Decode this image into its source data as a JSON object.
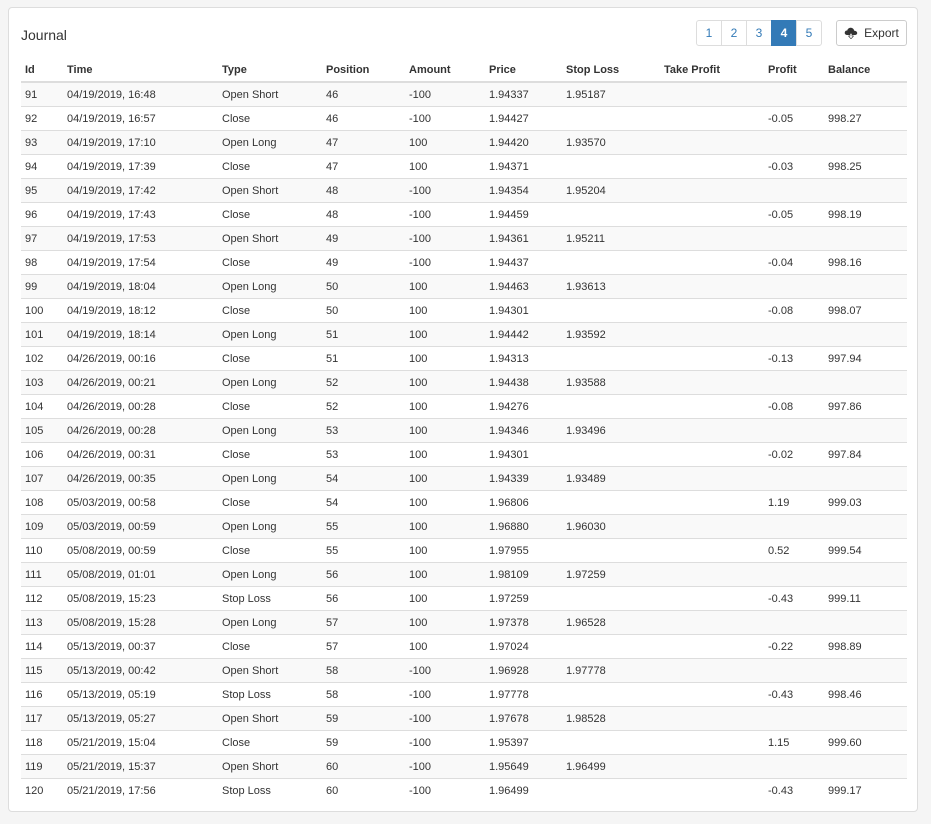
{
  "panel": {
    "title": "Journal"
  },
  "pagination": {
    "pages": [
      "1",
      "2",
      "3",
      "4",
      "5"
    ],
    "active_index": 3
  },
  "export": {
    "label": "Export",
    "icon": "cloud-download-icon"
  },
  "table": {
    "columns": [
      "Id",
      "Time",
      "Type",
      "Position",
      "Amount",
      "Price",
      "Stop Loss",
      "Take Profit",
      "Profit",
      "Balance"
    ],
    "rows": [
      [
        "91",
        "04/19/2019, 16:48",
        "Open Short",
        "46",
        "-100",
        "1.94337",
        "1.95187",
        "",
        "",
        ""
      ],
      [
        "92",
        "04/19/2019, 16:57",
        "Close",
        "46",
        "-100",
        "1.94427",
        "",
        "",
        "-0.05",
        "998.27"
      ],
      [
        "93",
        "04/19/2019, 17:10",
        "Open Long",
        "47",
        "100",
        "1.94420",
        "1.93570",
        "",
        "",
        ""
      ],
      [
        "94",
        "04/19/2019, 17:39",
        "Close",
        "47",
        "100",
        "1.94371",
        "",
        "",
        "-0.03",
        "998.25"
      ],
      [
        "95",
        "04/19/2019, 17:42",
        "Open Short",
        "48",
        "-100",
        "1.94354",
        "1.95204",
        "",
        "",
        ""
      ],
      [
        "96",
        "04/19/2019, 17:43",
        "Close",
        "48",
        "-100",
        "1.94459",
        "",
        "",
        "-0.05",
        "998.19"
      ],
      [
        "97",
        "04/19/2019, 17:53",
        "Open Short",
        "49",
        "-100",
        "1.94361",
        "1.95211",
        "",
        "",
        ""
      ],
      [
        "98",
        "04/19/2019, 17:54",
        "Close",
        "49",
        "-100",
        "1.94437",
        "",
        "",
        "-0.04",
        "998.16"
      ],
      [
        "99",
        "04/19/2019, 18:04",
        "Open Long",
        "50",
        "100",
        "1.94463",
        "1.93613",
        "",
        "",
        ""
      ],
      [
        "100",
        "04/19/2019, 18:12",
        "Close",
        "50",
        "100",
        "1.94301",
        "",
        "",
        "-0.08",
        "998.07"
      ],
      [
        "101",
        "04/19/2019, 18:14",
        "Open Long",
        "51",
        "100",
        "1.94442",
        "1.93592",
        "",
        "",
        ""
      ],
      [
        "102",
        "04/26/2019, 00:16",
        "Close",
        "51",
        "100",
        "1.94313",
        "",
        "",
        "-0.13",
        "997.94"
      ],
      [
        "103",
        "04/26/2019, 00:21",
        "Open Long",
        "52",
        "100",
        "1.94438",
        "1.93588",
        "",
        "",
        ""
      ],
      [
        "104",
        "04/26/2019, 00:28",
        "Close",
        "52",
        "100",
        "1.94276",
        "",
        "",
        "-0.08",
        "997.86"
      ],
      [
        "105",
        "04/26/2019, 00:28",
        "Open Long",
        "53",
        "100",
        "1.94346",
        "1.93496",
        "",
        "",
        ""
      ],
      [
        "106",
        "04/26/2019, 00:31",
        "Close",
        "53",
        "100",
        "1.94301",
        "",
        "",
        "-0.02",
        "997.84"
      ],
      [
        "107",
        "04/26/2019, 00:35",
        "Open Long",
        "54",
        "100",
        "1.94339",
        "1.93489",
        "",
        "",
        ""
      ],
      [
        "108",
        "05/03/2019, 00:58",
        "Close",
        "54",
        "100",
        "1.96806",
        "",
        "",
        "1.19",
        "999.03"
      ],
      [
        "109",
        "05/03/2019, 00:59",
        "Open Long",
        "55",
        "100",
        "1.96880",
        "1.96030",
        "",
        "",
        ""
      ],
      [
        "110",
        "05/08/2019, 00:59",
        "Close",
        "55",
        "100",
        "1.97955",
        "",
        "",
        "0.52",
        "999.54"
      ],
      [
        "111",
        "05/08/2019, 01:01",
        "Open Long",
        "56",
        "100",
        "1.98109",
        "1.97259",
        "",
        "",
        ""
      ],
      [
        "112",
        "05/08/2019, 15:23",
        "Stop Loss",
        "56",
        "100",
        "1.97259",
        "",
        "",
        "-0.43",
        "999.11"
      ],
      [
        "113",
        "05/08/2019, 15:28",
        "Open Long",
        "57",
        "100",
        "1.97378",
        "1.96528",
        "",
        "",
        ""
      ],
      [
        "114",
        "05/13/2019, 00:37",
        "Close",
        "57",
        "100",
        "1.97024",
        "",
        "",
        "-0.22",
        "998.89"
      ],
      [
        "115",
        "05/13/2019, 00:42",
        "Open Short",
        "58",
        "-100",
        "1.96928",
        "1.97778",
        "",
        "",
        ""
      ],
      [
        "116",
        "05/13/2019, 05:19",
        "Stop Loss",
        "58",
        "-100",
        "1.97778",
        "",
        "",
        "-0.43",
        "998.46"
      ],
      [
        "117",
        "05/13/2019, 05:27",
        "Open Short",
        "59",
        "-100",
        "1.97678",
        "1.98528",
        "",
        "",
        ""
      ],
      [
        "118",
        "05/21/2019, 15:04",
        "Close",
        "59",
        "-100",
        "1.95397",
        "",
        "",
        "1.15",
        "999.60"
      ],
      [
        "119",
        "05/21/2019, 15:37",
        "Open Short",
        "60",
        "-100",
        "1.95649",
        "1.96499",
        "",
        "",
        ""
      ],
      [
        "120",
        "05/21/2019, 17:56",
        "Stop Loss",
        "60",
        "-100",
        "1.96499",
        "",
        "",
        "-0.43",
        "999.17"
      ]
    ]
  },
  "colors": {
    "accent": "#337ab7",
    "border": "#dddddd",
    "stripe": "#f9f9f9"
  }
}
